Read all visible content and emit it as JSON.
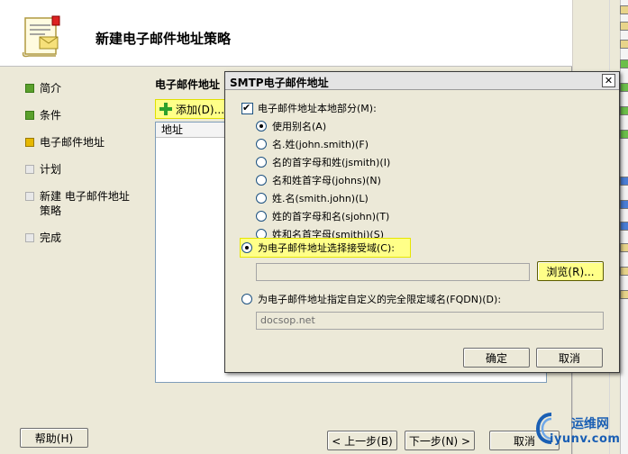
{
  "wizard": {
    "title": "新建电子邮件地址策略",
    "steps": [
      {
        "label": "简介",
        "state": "done"
      },
      {
        "label": "条件",
        "state": "done"
      },
      {
        "label": "电子邮件地址",
        "state": "active"
      },
      {
        "label": "计划",
        "state": "pending"
      },
      {
        "label": "新建 电子邮件地址策略",
        "state": "pending"
      },
      {
        "label": "完成",
        "state": "pending"
      }
    ],
    "section_title": "电子邮件地址",
    "add_label": "添加(D)...",
    "list_header": "地址",
    "buttons": {
      "help": "帮助(H)",
      "back": "< 上一步(B)",
      "next": "下一步(N) >",
      "cancel": "取消"
    }
  },
  "dialog": {
    "title": "SMTP电子邮件地址",
    "close_glyph": "✕",
    "local_part_label": "电子邮件地址本地部分(M):",
    "local_part_checked": true,
    "local_options": [
      {
        "label": "使用别名(A)",
        "selected": true
      },
      {
        "label": "名.姓(john.smith)(F)",
        "selected": false
      },
      {
        "label": "名的首字母和姓(jsmith)(I)",
        "selected": false
      },
      {
        "label": "名和姓首字母(johns)(N)",
        "selected": false
      },
      {
        "label": "姓.名(smith.john)(L)",
        "selected": false
      },
      {
        "label": "姓的首字母和名(sjohn)(T)",
        "selected": false
      },
      {
        "label": "姓和名首字母(smithj)(S)",
        "selected": false
      }
    ],
    "accepted_domain_label": "为电子邮件地址选择接受域(C):",
    "accepted_domain_selected": true,
    "accepted_domain_value": "",
    "browse_label": "浏览(R)...",
    "fqdn_label": "为电子邮件地址指定自定义的完全限定域名(FQDN)(D):",
    "fqdn_selected": false,
    "fqdn_value": "docsop.net",
    "ok_label": "确定",
    "cancel_label": "取消"
  },
  "watermark": {
    "line1": "运维网",
    "line2": "iyunv.com"
  },
  "colors": {
    "highlight": "#ffff88",
    "step_done": "#5aa02c",
    "step_active": "#e6b800",
    "watermark": "#1a5fb4"
  }
}
